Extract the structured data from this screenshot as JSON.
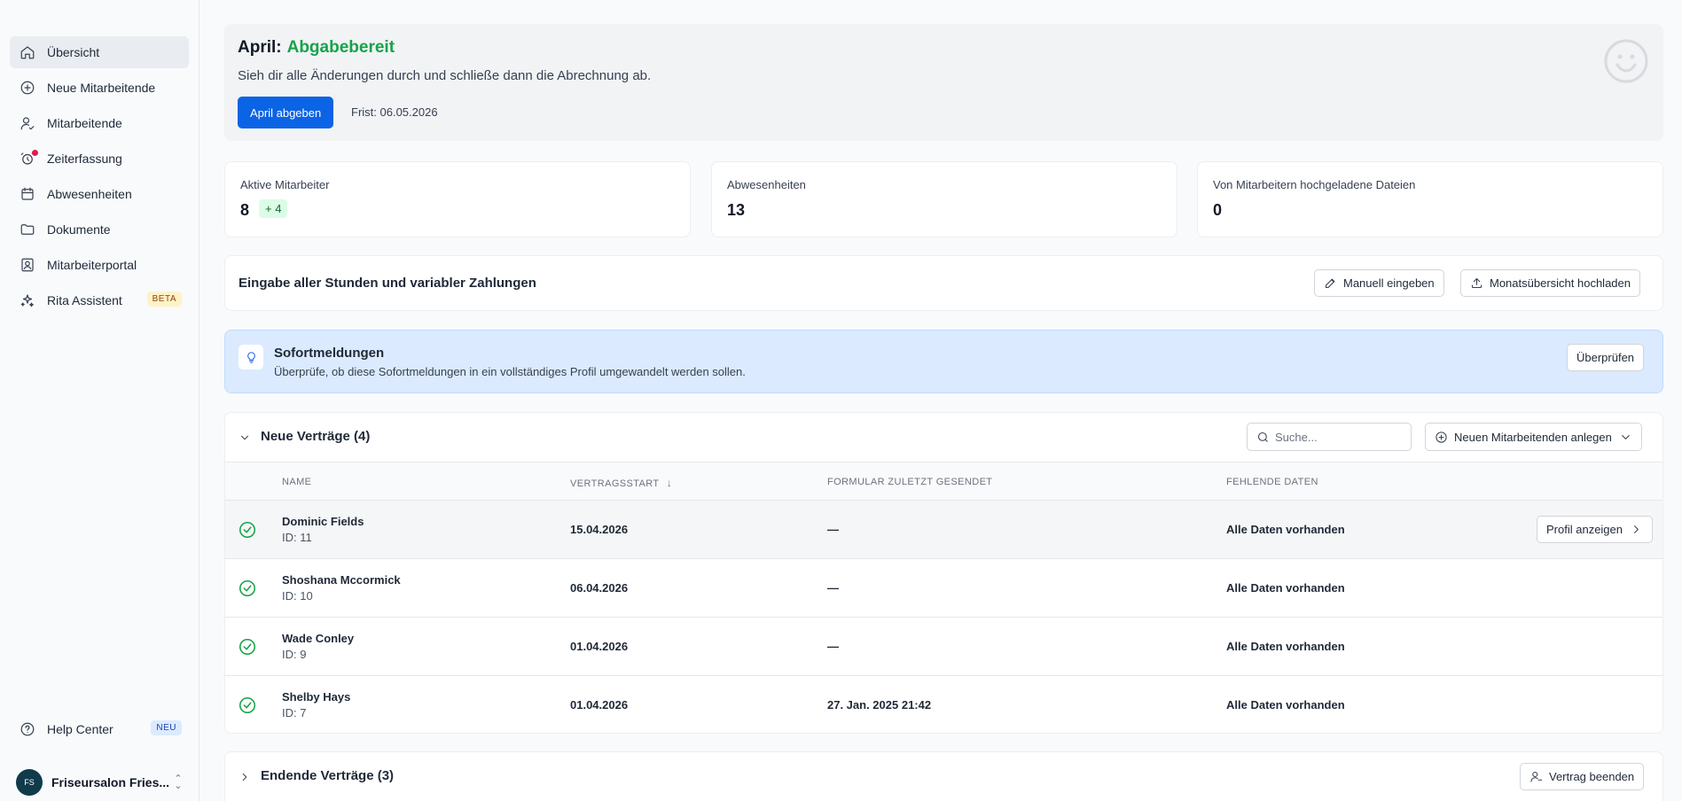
{
  "sidebar": {
    "items": [
      {
        "label": "Übersicht",
        "icon": "home-icon",
        "active": true
      },
      {
        "label": "Neue Mitarbeitende",
        "icon": "plus-circle-icon"
      },
      {
        "label": "Mitarbeitende",
        "icon": "user-check-icon"
      },
      {
        "label": "Zeiterfassung",
        "icon": "alarm-clock-icon",
        "notification_dot": true
      },
      {
        "label": "Abwesenheiten",
        "icon": "calendar-icon"
      },
      {
        "label": "Dokumente",
        "icon": "folder-icon"
      },
      {
        "label": "Mitarbeiterportal",
        "icon": "portal-icon"
      },
      {
        "label": "Rita Assistent",
        "icon": "sparkles-icon",
        "badge": "BETA"
      }
    ],
    "help": {
      "label": "Help Center",
      "icon": "help-circle-icon",
      "badge": "NEU"
    },
    "org": {
      "name": "Friseursalon Fries...",
      "avatar_text": "FS"
    }
  },
  "banner": {
    "month": "April:",
    "status": "Abgabebereit",
    "subtitle": "Sieh dir alle Änderungen durch und schließe dann die Abrechnung ab.",
    "button": "April abgeben",
    "deadline": "Frist: 06.05.2026",
    "status_color": "#16a34a"
  },
  "stats": [
    {
      "label": "Aktive Mitarbeiter",
      "value": "8",
      "delta": "+ 4"
    },
    {
      "label": "Abwesenheiten",
      "value": "13"
    },
    {
      "label": "Von Mitarbeitern hochgeladene Dateien",
      "value": "0"
    }
  ],
  "entry": {
    "title": "Eingabe aller Stunden und variabler Zahlungen",
    "manual_button": "Manuell eingeben",
    "upload_button": "Monatsübersicht hochladen"
  },
  "info": {
    "title": "Sofortmeldungen",
    "subtitle": "Überprüfe, ob diese Sofortmeldungen in ein vollständiges Profil umgewandelt werden sollen.",
    "button": "Überprüfen"
  },
  "contracts": {
    "title": "Neue Verträge (4)",
    "search_placeholder": "Suche...",
    "add_button": "Neuen Mitarbeitenden anlegen",
    "columns": [
      "NAME",
      "VERTRAGSSTART",
      "FORMULAR ZULETZT GESENDET",
      "FEHLENDE DATEN"
    ],
    "rows": [
      {
        "name": "Dominic Fields",
        "id": "ID: 11",
        "start": "15.04.2026",
        "sent": "—",
        "missing": "Alle Daten vorhanden"
      },
      {
        "name": "Shoshana Mccormick",
        "id": "ID: 10",
        "start": "06.04.2026",
        "sent": "—",
        "missing": "Alle Daten vorhanden"
      },
      {
        "name": "Wade Conley",
        "id": "ID: 9",
        "start": "01.04.2026",
        "sent": "—",
        "missing": "Alle Daten vorhanden"
      },
      {
        "name": "Shelby Hays",
        "id": "ID: 7",
        "start": "01.04.2026",
        "sent": "27. Jan. 2025 21:42",
        "missing": "Alle Daten vorhanden"
      }
    ],
    "profile_button": "Profil anzeigen"
  },
  "ending": {
    "title": "Endende Verträge (3)",
    "button": "Vertrag beenden"
  }
}
